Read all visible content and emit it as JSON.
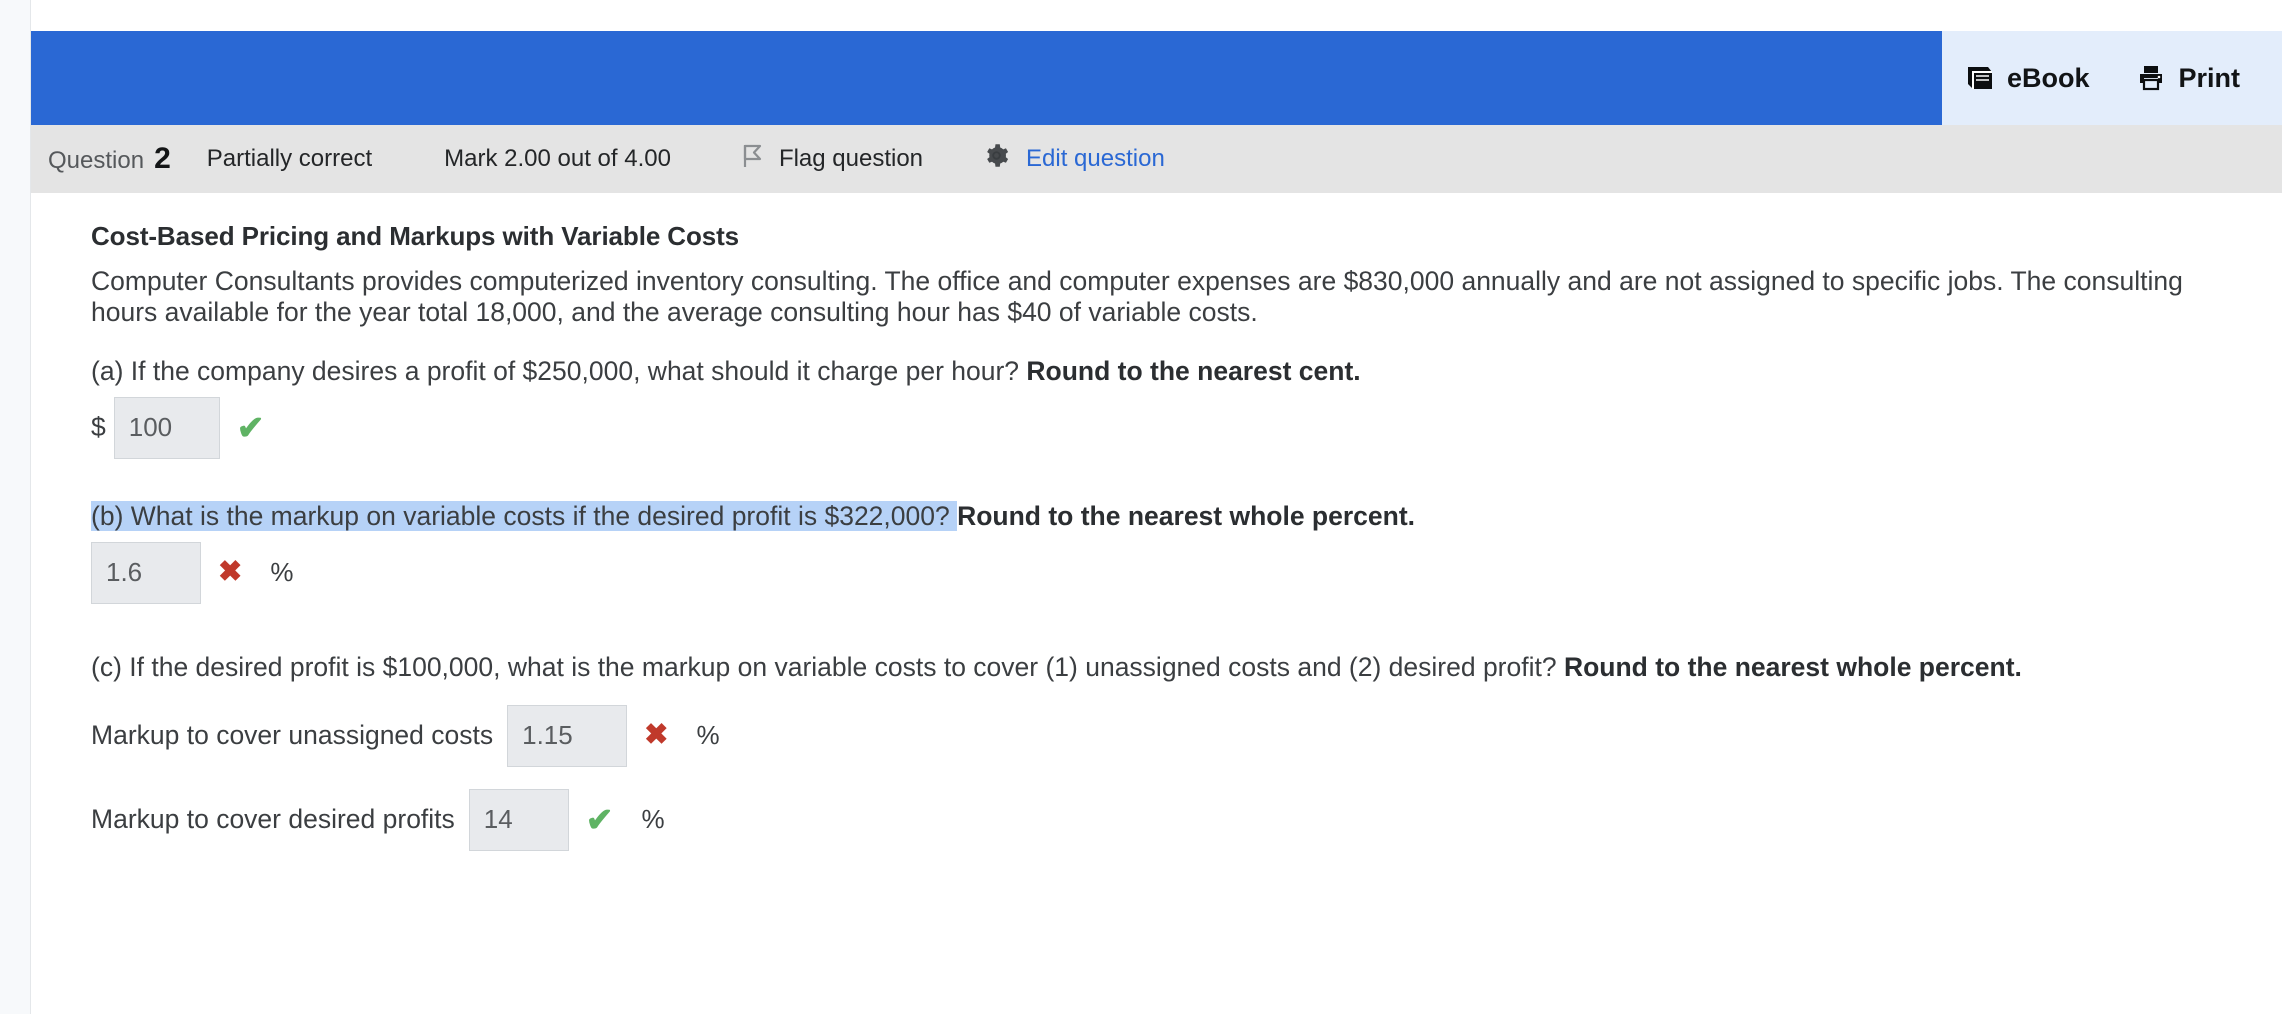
{
  "banner": {
    "tools": [
      {
        "label": "eBook",
        "icon": "book-icon"
      },
      {
        "label": "Print",
        "icon": "printer-icon"
      }
    ]
  },
  "question_info": {
    "question_label": "Question",
    "question_number": "2",
    "state": "Partially correct",
    "mark": "Mark 2.00 out of 4.00",
    "flag_label": "Flag question",
    "flag_icon": "flag-icon",
    "edit_label": "Edit question",
    "edit_icon": "gear-icon",
    "edit_link_color": "#2a68d4"
  },
  "question": {
    "title": "Cost-Based Pricing and Markups with Variable Costs",
    "intro": "Computer Consultants provides computerized inventory consulting. The office and computer expenses are $830,000 annually and are not assigned to specific jobs. The consulting hours available for the year total 18,000, and the average consulting hour has $40 of variable costs.",
    "parts": [
      {
        "id": "a",
        "prompt": "(a) If the company desires a profit of $250,000, what should it charge per hour? ",
        "prompt_bold": "Round to the nearest cent.",
        "currency_prefix": "$",
        "answer_value": "100",
        "grade": "correct",
        "grade_icon": "check-icon",
        "suffix": ""
      },
      {
        "id": "b",
        "prompt": "(b) What is the markup on variable costs if the desired profit is $322,000? ",
        "prompt_bold": "Round to the nearest whole percent.",
        "prompt_highlighted": true,
        "currency_prefix": "",
        "answer_value": "1.6",
        "grade": "incorrect",
        "grade_icon": "cross-icon",
        "suffix": "%"
      },
      {
        "id": "c",
        "prompt": "(c) If the desired profit is $100,000, what is the markup on variable costs to cover (1) unassigned costs and (2) desired profit? ",
        "prompt_bold": "Round to the nearest whole percent.",
        "rows": [
          {
            "label": "Markup to cover unassigned costs",
            "answer_value": "1.15",
            "grade": "incorrect",
            "grade_icon": "cross-icon",
            "suffix": "%"
          },
          {
            "label": "Markup to cover desired profits",
            "answer_value": "14",
            "grade": "correct",
            "grade_icon": "check-icon",
            "suffix": "%"
          }
        ]
      }
    ]
  },
  "glyphs": {
    "check": "✔",
    "cross": "✖"
  },
  "colors": {
    "banner_blue": "#2a68d4",
    "tools_bg": "#e3edfb",
    "info_bar": "#e4e4e4",
    "input_bg": "#e8eaed",
    "selection": "#b6d2f7",
    "correct_green": "#5fb364",
    "incorrect_red": "#c0392b"
  }
}
